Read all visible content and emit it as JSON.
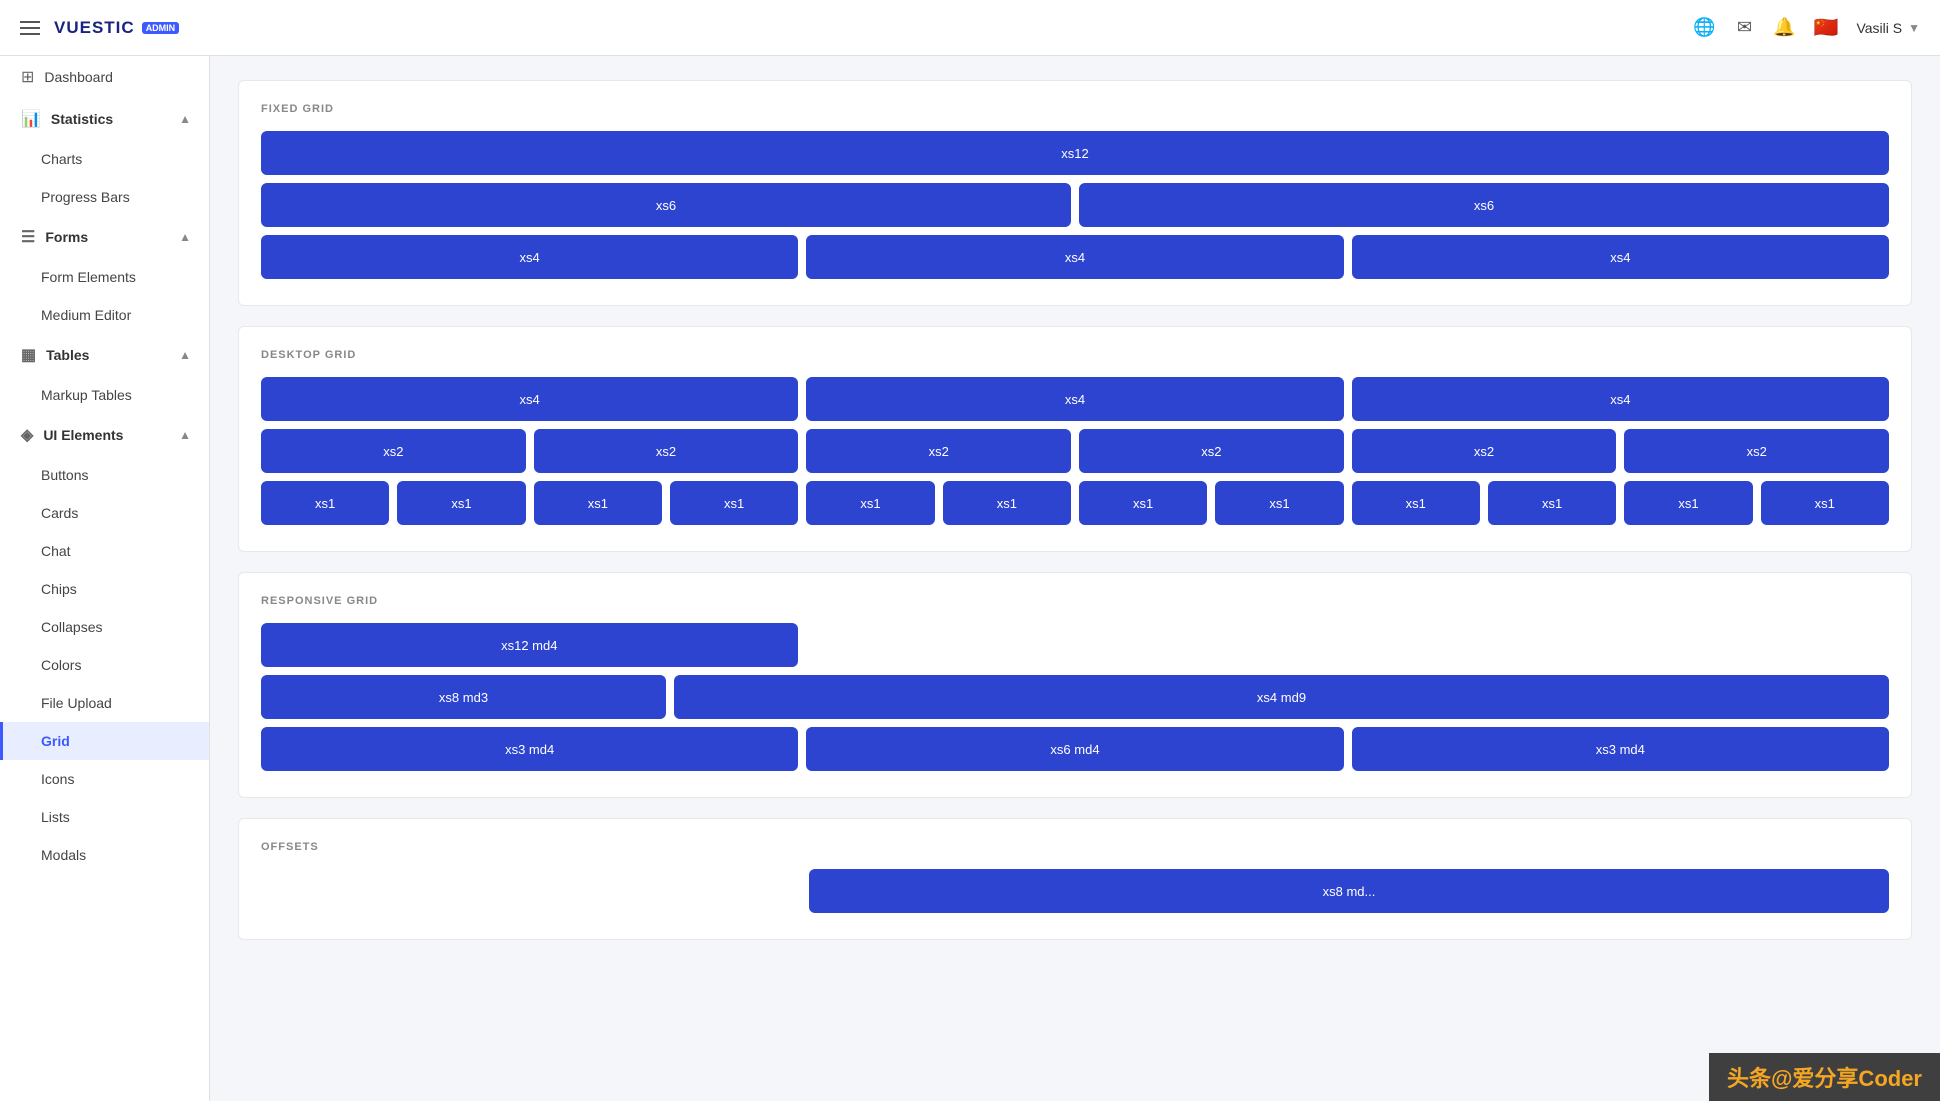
{
  "topnav": {
    "logo_text": "VUESTIC",
    "logo_badge": "ADMIN",
    "user_name": "Vasili S"
  },
  "sidebar": {
    "items": [
      {
        "id": "dashboard",
        "label": "Dashboard",
        "icon": "⊞",
        "type": "link",
        "active": false
      },
      {
        "id": "statistics",
        "label": "Statistics",
        "icon": "📊",
        "type": "section",
        "expanded": true
      },
      {
        "id": "charts",
        "label": "Charts",
        "icon": "",
        "type": "child",
        "active": false
      },
      {
        "id": "progress-bars",
        "label": "Progress Bars",
        "icon": "",
        "type": "child",
        "active": false
      },
      {
        "id": "forms",
        "label": "Forms",
        "icon": "☰",
        "type": "section",
        "expanded": true
      },
      {
        "id": "form-elements",
        "label": "Form Elements",
        "icon": "",
        "type": "child",
        "active": false
      },
      {
        "id": "medium-editor",
        "label": "Medium Editor",
        "icon": "",
        "type": "child",
        "active": false
      },
      {
        "id": "tables",
        "label": "Tables",
        "icon": "▦",
        "type": "section",
        "expanded": true
      },
      {
        "id": "markup-tables",
        "label": "Markup Tables",
        "icon": "",
        "type": "child",
        "active": false
      },
      {
        "id": "ui-elements",
        "label": "UI Elements",
        "icon": "◈",
        "type": "section",
        "expanded": true
      },
      {
        "id": "buttons",
        "label": "Buttons",
        "icon": "",
        "type": "child",
        "active": false
      },
      {
        "id": "cards",
        "label": "Cards",
        "icon": "",
        "type": "child",
        "active": false
      },
      {
        "id": "chat",
        "label": "Chat",
        "icon": "",
        "type": "child",
        "active": false
      },
      {
        "id": "chips",
        "label": "Chips",
        "icon": "",
        "type": "child",
        "active": false
      },
      {
        "id": "collapses",
        "label": "Collapses",
        "icon": "",
        "type": "child",
        "active": false
      },
      {
        "id": "colors",
        "label": "Colors",
        "icon": "",
        "type": "child",
        "active": false
      },
      {
        "id": "file-upload",
        "label": "File Upload",
        "icon": "",
        "type": "child",
        "active": false
      },
      {
        "id": "grid",
        "label": "Grid",
        "icon": "",
        "type": "child",
        "active": true
      },
      {
        "id": "icons",
        "label": "Icons",
        "icon": "",
        "type": "child",
        "active": false
      },
      {
        "id": "lists",
        "label": "Lists",
        "icon": "",
        "type": "child",
        "active": false
      },
      {
        "id": "modals",
        "label": "Modals",
        "icon": "",
        "type": "child",
        "active": false
      }
    ]
  },
  "page": {
    "sections": [
      {
        "id": "fixed-grid",
        "title": "FIXED GRID",
        "rows": [
          [
            {
              "label": "xs12",
              "flex": 12
            }
          ],
          [
            {
              "label": "xs6",
              "flex": 6
            },
            {
              "label": "xs6",
              "flex": 6
            }
          ],
          [
            {
              "label": "xs4",
              "flex": 4
            },
            {
              "label": "xs4",
              "flex": 4
            },
            {
              "label": "xs4",
              "flex": 4
            }
          ]
        ]
      },
      {
        "id": "desktop-grid",
        "title": "DESKTOP GRID",
        "rows": [
          [
            {
              "label": "xs4",
              "flex": 4
            },
            {
              "label": "xs4",
              "flex": 4
            },
            {
              "label": "xs4",
              "flex": 4
            }
          ],
          [
            {
              "label": "xs2",
              "flex": 2
            },
            {
              "label": "xs2",
              "flex": 2
            },
            {
              "label": "xs2",
              "flex": 2
            },
            {
              "label": "xs2",
              "flex": 2
            },
            {
              "label": "xs2",
              "flex": 2
            },
            {
              "label": "xs2",
              "flex": 2
            }
          ],
          [
            {
              "label": "xs1",
              "flex": 1
            },
            {
              "label": "xs1",
              "flex": 1
            },
            {
              "label": "xs1",
              "flex": 1
            },
            {
              "label": "xs1",
              "flex": 1
            },
            {
              "label": "xs1",
              "flex": 1
            },
            {
              "label": "xs1",
              "flex": 1
            },
            {
              "label": "xs1",
              "flex": 1
            },
            {
              "label": "xs1",
              "flex": 1
            },
            {
              "label": "xs1",
              "flex": 1
            },
            {
              "label": "xs1",
              "flex": 1
            },
            {
              "label": "xs1",
              "flex": 1
            },
            {
              "label": "xs1",
              "flex": 1
            }
          ]
        ]
      },
      {
        "id": "responsive-grid",
        "title": "RESPONSIVE GRID",
        "rows": [
          [
            {
              "label": "xs12 md4",
              "flex": 4
            }
          ],
          [
            {
              "label": "xs8 md3",
              "flex": 3
            },
            {
              "label": "xs4 md9",
              "flex": 9
            }
          ],
          [
            {
              "label": "xs3 md4",
              "flex": 4
            },
            {
              "label": "xs6 md4",
              "flex": 4
            },
            {
              "label": "xs3 md4",
              "flex": 4
            }
          ]
        ]
      },
      {
        "id": "offsets",
        "title": "OFFSETS",
        "rows": [
          [
            {
              "label": "xs8 md...",
              "flex": 8
            }
          ]
        ]
      }
    ]
  },
  "watermark": "头条@爱分享Coder"
}
